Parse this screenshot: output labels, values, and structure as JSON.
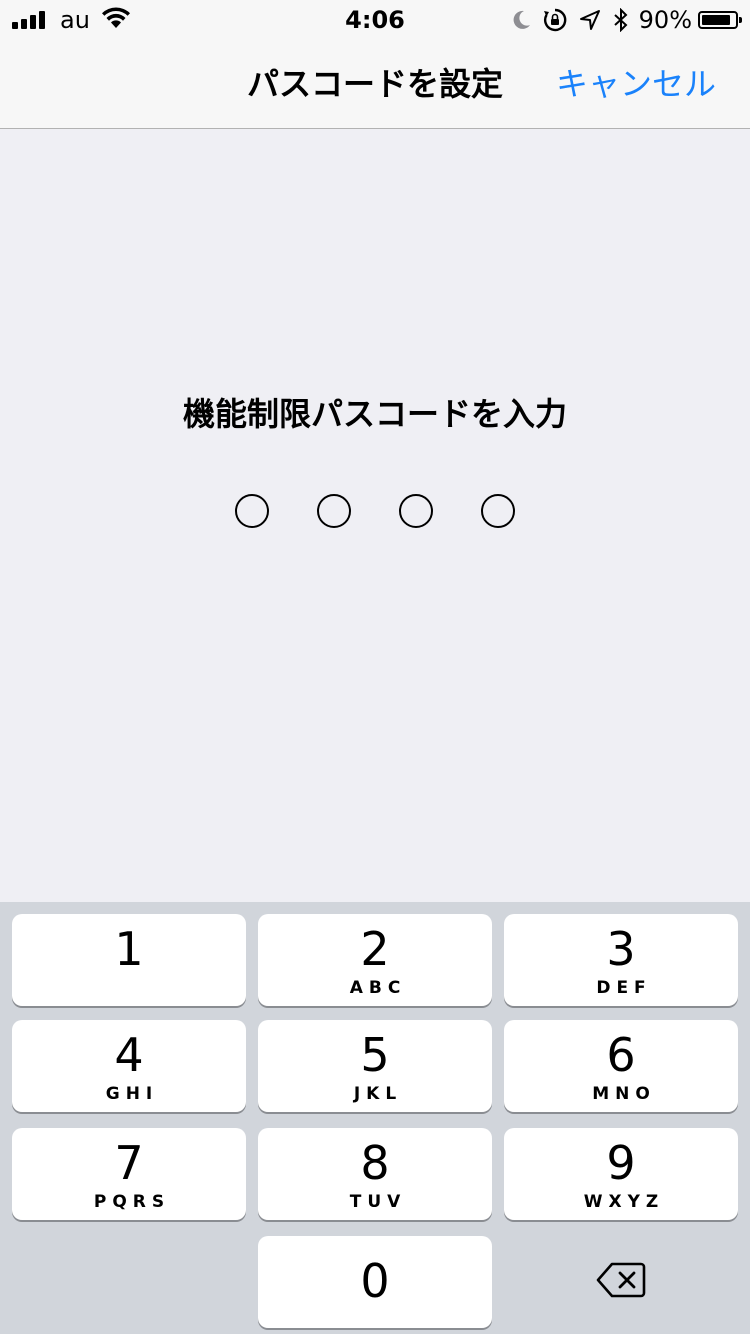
{
  "status_bar": {
    "carrier": "au",
    "time": "4:06",
    "battery_percent": "90%",
    "battery_level": 0.9,
    "icons": [
      "signal-icon",
      "wifi-icon",
      "moon-icon",
      "orientation-lock-icon",
      "location-icon",
      "bluetooth-icon",
      "battery-icon"
    ]
  },
  "nav": {
    "title": "パスコードを設定",
    "cancel_label": "キャンセル",
    "accent_color": "#1a82fb"
  },
  "prompt": "機能制限パスコードを入力",
  "passcode": {
    "length": 4,
    "entered": 0
  },
  "keypad": {
    "keys": [
      {
        "num": "1",
        "letters": ""
      },
      {
        "num": "2",
        "letters": "ABC"
      },
      {
        "num": "3",
        "letters": "DEF"
      },
      {
        "num": "4",
        "letters": "GHI"
      },
      {
        "num": "5",
        "letters": "JKL"
      },
      {
        "num": "6",
        "letters": "MNO"
      },
      {
        "num": "7",
        "letters": "PQRS"
      },
      {
        "num": "8",
        "letters": "TUV"
      },
      {
        "num": "9",
        "letters": "WXYZ"
      },
      {
        "num": "0",
        "letters": ""
      }
    ],
    "delete_icon": "backspace-icon"
  }
}
